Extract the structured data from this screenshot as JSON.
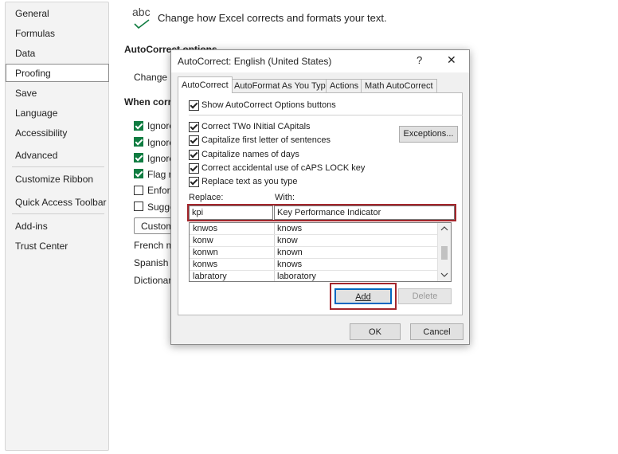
{
  "nav": {
    "items": [
      "General",
      "Formulas",
      "Data",
      "Proofing",
      "Save",
      "Language",
      "Accessibility",
      "Advanced",
      "Customize Ribbon",
      "Quick Access Toolbar",
      "Add-ins",
      "Trust Center"
    ],
    "selected": "Proofing"
  },
  "page": {
    "icon_text": "abc",
    "header": "Change how Excel corrects and formats your text.",
    "section_autocorrect": "AutoCorrect options",
    "change_how_label": "Change h",
    "section_when": "When corre",
    "options": [
      "Ignore",
      "Ignore",
      "Ignore",
      "Flag re",
      "Enforc",
      "Sugge"
    ],
    "custom_button": "Custom",
    "french_label": "French m",
    "spanish_label": "Spanish m",
    "dictionary_label": "Dictionary"
  },
  "dialog": {
    "title": "AutoCorrect: English (United States)",
    "help": "?",
    "close": "✕",
    "tabs": [
      "AutoCorrect",
      "AutoFormat As You Type",
      "Actions",
      "Math AutoCorrect"
    ],
    "show_options": "Show AutoCorrect Options buttons",
    "checks": [
      "Correct TWo INitial CApitals",
      "Capitalize first letter of sentences",
      "Capitalize names of days",
      "Correct accidental use of cAPS LOCK key",
      "Replace text as you type"
    ],
    "exceptions_button": "Exceptions...",
    "replace_label": "Replace:",
    "with_label": "With:",
    "replace_value": "kpi",
    "with_value": "Key Performance Indicator",
    "list": [
      {
        "replace": "knwos",
        "with": "knows"
      },
      {
        "replace": "konw",
        "with": "know"
      },
      {
        "replace": "konwn",
        "with": "known"
      },
      {
        "replace": "konws",
        "with": "knows"
      },
      {
        "replace": "labratory",
        "with": "laboratory"
      }
    ],
    "add_button": "Add",
    "delete_button": "Delete",
    "ok_button": "OK",
    "cancel_button": "Cancel"
  },
  "colors": {
    "accent_green": "#107c41",
    "highlight_red": "#a4262c",
    "focus_blue": "#0067c0"
  }
}
